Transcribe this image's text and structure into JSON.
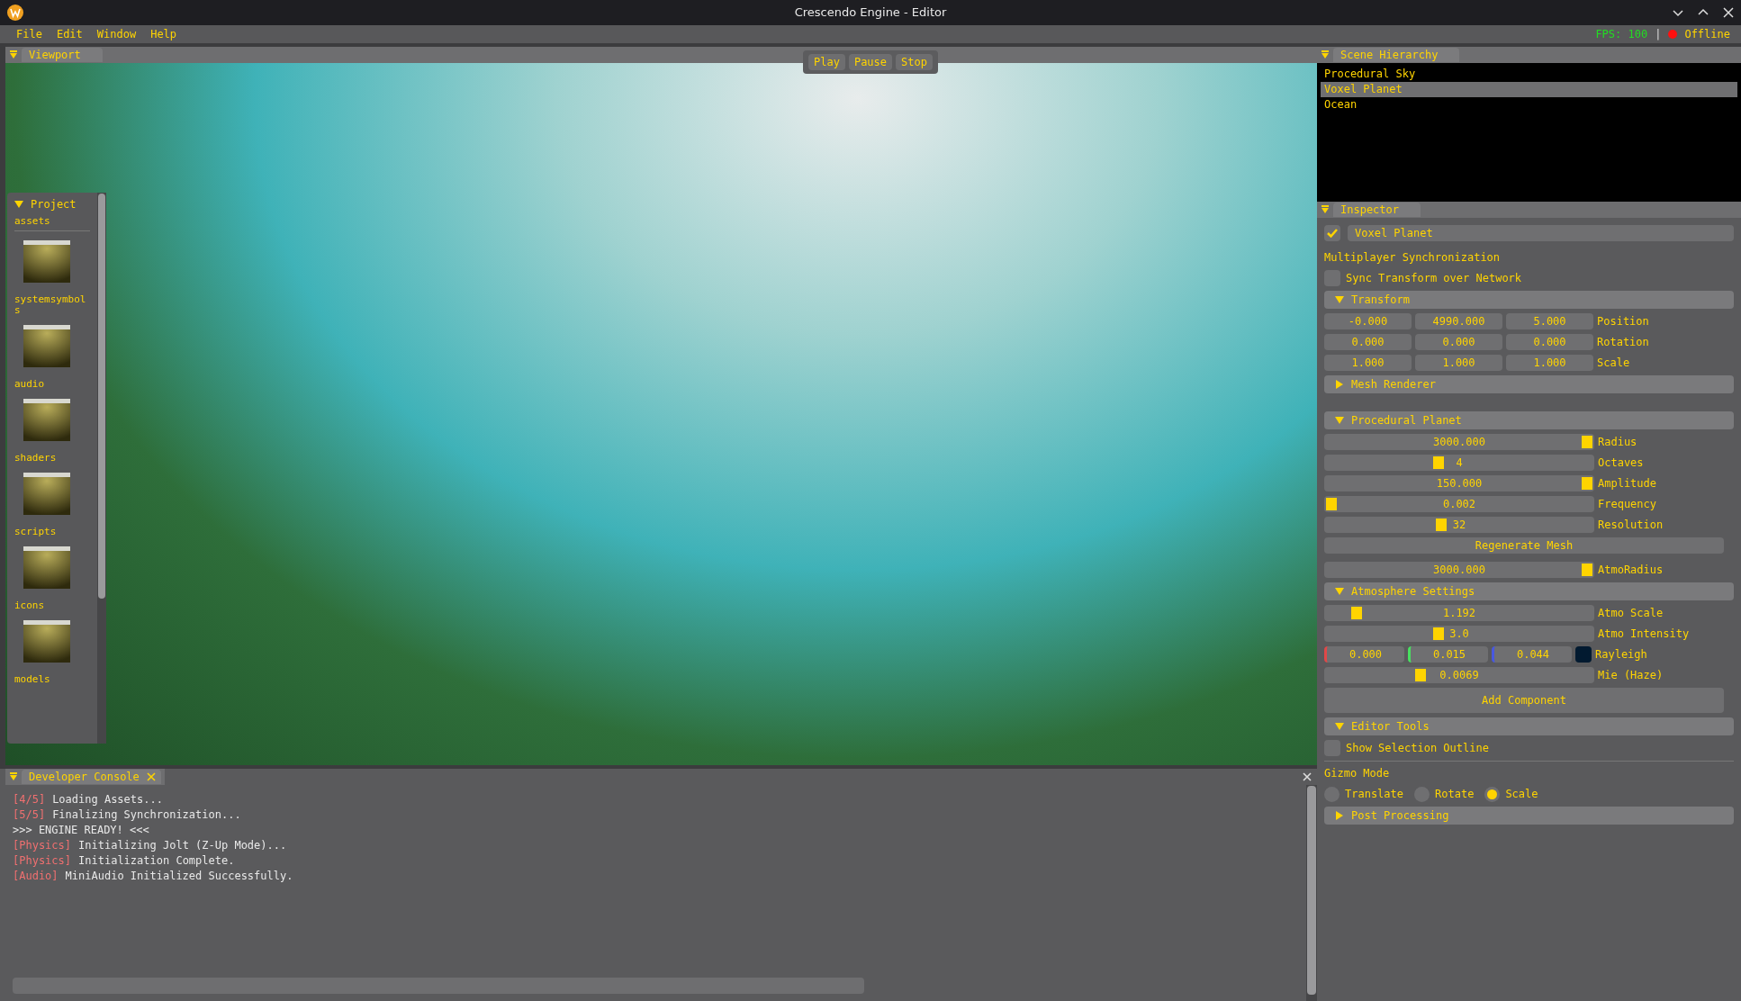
{
  "window": {
    "title": "Crescendo Engine - Editor"
  },
  "menu": [
    "File",
    "Edit",
    "Window",
    "Help"
  ],
  "status": {
    "fps": "FPS: 100",
    "separator": "|",
    "connection": "Offline",
    "online": false
  },
  "viewport": {
    "title": "Viewport",
    "toolbar": [
      "Play",
      "Pause",
      "Stop"
    ]
  },
  "project": {
    "title": "Project",
    "folders": [
      "assets",
      "systemsymbols",
      "audio",
      "shaders",
      "scripts",
      "icons",
      "models"
    ]
  },
  "hierarchy": {
    "title": "Scene Hierarchy",
    "items": [
      {
        "label": "Procedural Sky",
        "selected": false
      },
      {
        "label": "Voxel Planet",
        "selected": true
      },
      {
        "label": "Ocean",
        "selected": false
      }
    ]
  },
  "inspector": {
    "title": "Inspector",
    "enabled": true,
    "name": "Voxel Planet",
    "sync_heading": "Multiplayer Synchronization",
    "sync": {
      "label": "Sync Transform over Network",
      "checked": false
    },
    "transform": {
      "title": "Transform",
      "expanded": true,
      "rows": [
        {
          "label": "Position",
          "values": [
            "-0.000",
            "4990.000",
            "5.000"
          ]
        },
        {
          "label": "Rotation",
          "values": [
            "0.000",
            "0.000",
            "0.000"
          ]
        },
        {
          "label": "Scale",
          "values": [
            "1.000",
            "1.000",
            "1.000"
          ]
        }
      ]
    },
    "mesh_renderer": {
      "title": "Mesh Renderer",
      "expanded": false
    },
    "planet": {
      "title": "Procedural Planet",
      "expanded": true,
      "sliders": [
        {
          "label": "Radius",
          "value": "3000.000",
          "level": 1
        },
        {
          "label": "Octaves",
          "value": "4",
          "level": 0.42
        },
        {
          "label": "Amplitude",
          "value": "150.000",
          "level": 1
        },
        {
          "label": "Frequency",
          "value": "0.002",
          "level": 0
        },
        {
          "label": "Resolution",
          "value": "32",
          "level": 0.43
        }
      ],
      "button": "Regenerate Mesh",
      "atmo_radius": {
        "label": "AtmoRadius",
        "value": "3000.000",
        "level": 1
      }
    },
    "atmosphere": {
      "title": "Atmosphere Settings",
      "expanded": true,
      "sliders": [
        {
          "label": "Atmo Scale",
          "value": "1.192",
          "level": 0.1
        },
        {
          "label": "Atmo Intensity",
          "value": "3.0",
          "level": 0.42
        }
      ],
      "rayleigh": {
        "label": "Rayleigh",
        "values": [
          {
            "value": "0.000",
            "color": "#e04848"
          },
          {
            "value": "0.015",
            "color": "#48e060"
          },
          {
            "value": "0.044",
            "color": "#4858e0"
          }
        ],
        "color": "#021a30"
      },
      "mie": {
        "label": "Mie (Haze)",
        "value": "0.0069",
        "level": 0.35
      }
    },
    "add_component": "Add Component",
    "editor_tools": {
      "title": "Editor Tools",
      "expanded": true,
      "outline": {
        "label": "Show Selection Outline",
        "checked": false
      },
      "gizmo_heading": "Gizmo Mode",
      "gizmo": [
        {
          "label": "Translate",
          "selected": false
        },
        {
          "label": "Rotate",
          "selected": false
        },
        {
          "label": "Scale",
          "selected": true
        }
      ]
    },
    "post_processing": {
      "title": "Post Processing",
      "expanded": false
    }
  },
  "console": {
    "title": "Developer Console",
    "lines": [
      {
        "tag": "[4/5]",
        "text": "Loading Assets..."
      },
      {
        "tag": "[5/5]",
        "text": "Finalizing Synchronization..."
      },
      {
        "text": ">>> ENGINE READY! <<<"
      },
      {
        "tag": "[Physics]",
        "text": "Initializing Jolt (Z-Up Mode)..."
      },
      {
        "tag": "[Physics]",
        "text": "Initialization Complete."
      },
      {
        "tag": "[Audio]",
        "text": "MiniAudio Initialized Successfully."
      }
    ]
  }
}
